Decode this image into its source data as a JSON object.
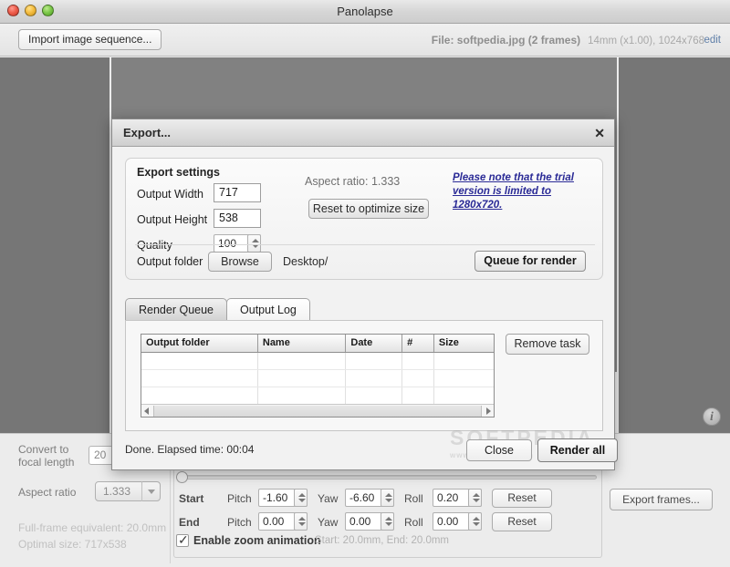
{
  "window": {
    "title": "Panolapse",
    "traffic_lights": [
      "close",
      "minimize",
      "zoom"
    ]
  },
  "toolbar": {
    "import_label": "Import image sequence...",
    "file_label": "File: softpedia.jpg (2 frames)",
    "file_dims": "14mm (x1.00), 1024x768",
    "edit_label": "edit"
  },
  "preview": {
    "info_icon_label": "i"
  },
  "bottom_panel": {
    "convert_label_line1": "Convert to",
    "convert_label_line2": "focal length",
    "focal_value": "20",
    "aspect_ratio_label": "Aspect ratio",
    "aspect_ratio_value": "1.333",
    "full_frame_equivalent": "Full-frame equivalent: 20.0mm",
    "optimal_size": "Optimal size: 717x538",
    "export_frames_label": "Export frames...",
    "rows": [
      {
        "name": "Start",
        "pitch_label": "Pitch",
        "pitch": "-1.60",
        "yaw_label": "Yaw",
        "yaw": "-6.60",
        "roll_label": "Roll",
        "roll": "0.20",
        "reset_label": "Reset"
      },
      {
        "name": "End",
        "pitch_label": "Pitch",
        "pitch": "0.00",
        "yaw_label": "Yaw",
        "yaw": "0.00",
        "roll_label": "Roll",
        "roll": "0.00",
        "reset_label": "Reset"
      }
    ],
    "zoom_checkbox_label": "Enable zoom animation",
    "zoom_note": "Start: 20.0mm, End: 20.0mm"
  },
  "dialog": {
    "title": "Export...",
    "close_icon": "✕",
    "settings": {
      "heading": "Export settings",
      "output_width_label": "Output Width",
      "output_width_value": "717",
      "output_height_label": "Output Height",
      "output_height_value": "538",
      "quality_label": "Quality",
      "quality_value": "100",
      "aspect_ratio_note": "Aspect ratio: 1.333",
      "reset_optimize_label": "Reset to optimize size",
      "trial_note": "Please note that the trial version is limited to 1280x720.",
      "output_folder_label": "Output folder",
      "browse_label": "Browse",
      "folder_path": "Desktop/",
      "queue_label": "Queue for render"
    },
    "tabs": [
      {
        "label": "Render Queue",
        "active": true
      },
      {
        "label": "Output Log",
        "active": false
      }
    ],
    "queue_table": {
      "columns": [
        "Output folder",
        "Name",
        "Date",
        "#",
        "Size"
      ],
      "rows": [],
      "empty_row_count": 3
    },
    "remove_task_label": "Remove task",
    "status": "Done. Elapsed time: 00:04",
    "close_label": "Close",
    "render_all_label": "Render all"
  },
  "watermark": {
    "text": "SOFTPEDIA",
    "sub": "www.softpedia.com"
  },
  "colors": {
    "link_blue": "#2a2a96",
    "edit_link": "#5f7fa8",
    "preview_gray": "#767676",
    "panel_bg": "#ececec"
  }
}
